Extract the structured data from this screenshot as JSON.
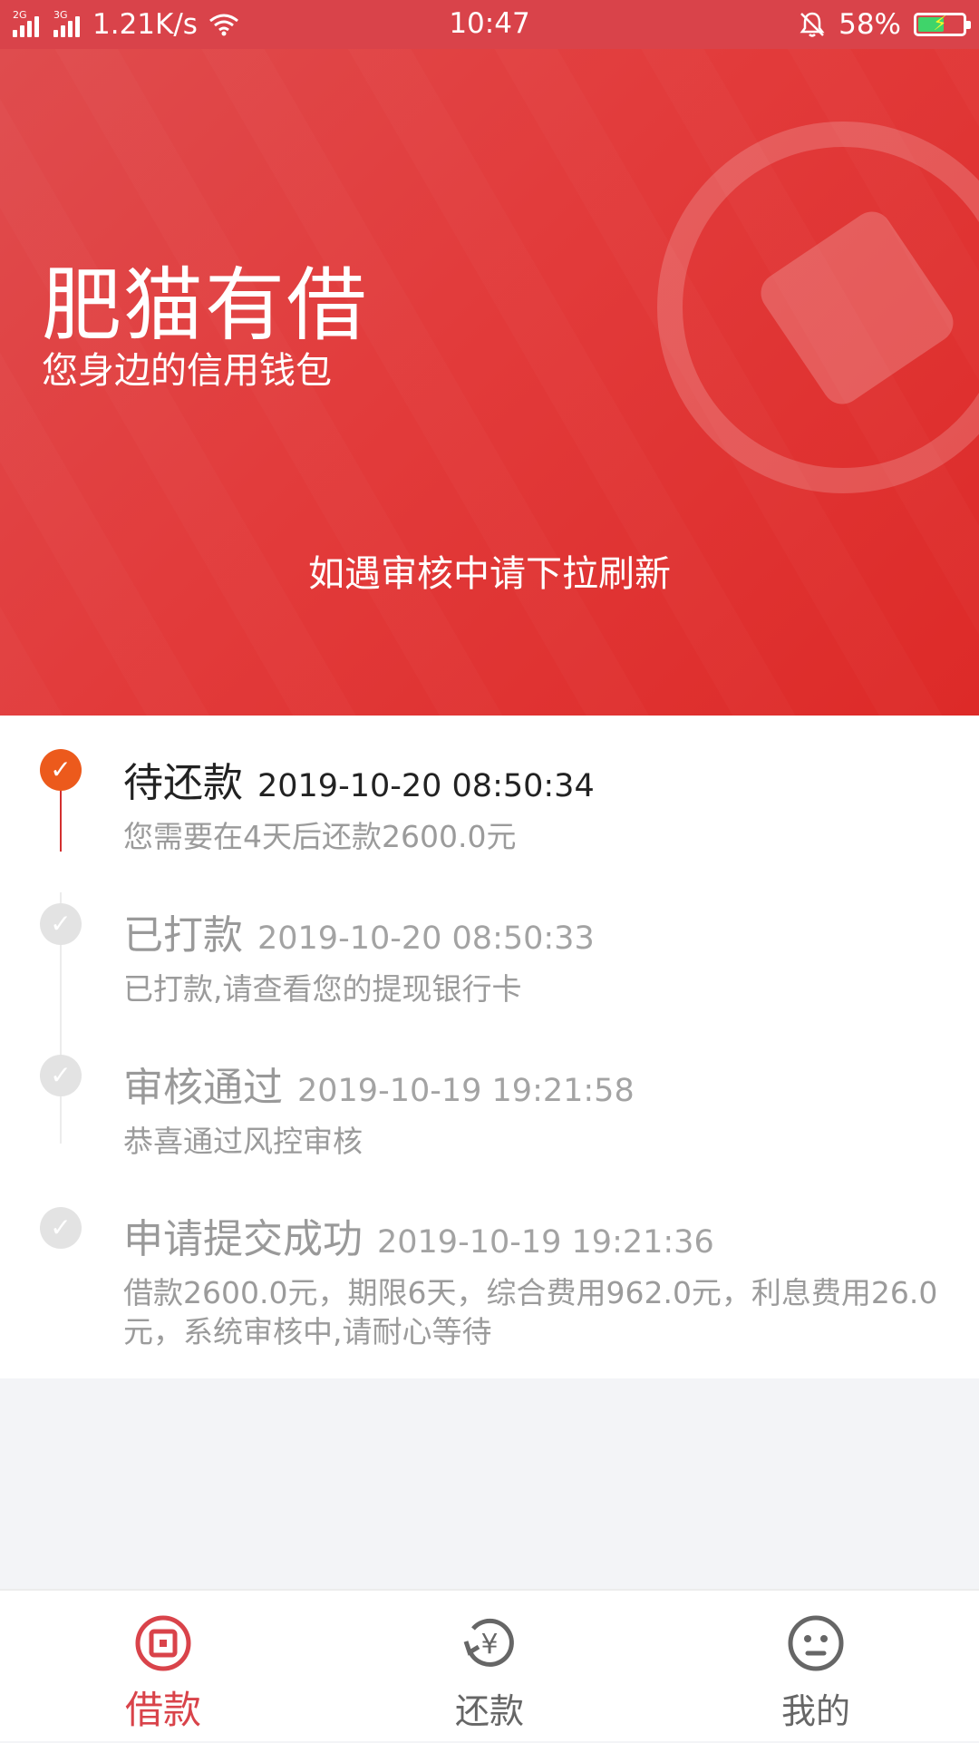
{
  "status_bar": {
    "net1": "2G",
    "net2": "3G",
    "speed": "1.21K/s",
    "time": "10:47",
    "battery": "58%"
  },
  "hero": {
    "title": "肥猫有借",
    "subtitle": "您身边的信用钱包",
    "hint": "如遇审核中请下拉刷新"
  },
  "timeline": {
    "items": [
      {
        "title": "待还款",
        "timestamp": "2019-10-20 08:50:34",
        "desc": "您需要在4天后还款2600.0元",
        "active": true
      },
      {
        "title": "已打款",
        "timestamp": "2019-10-20 08:50:33",
        "desc": "已打款,请查看您的提现银行卡",
        "active": false
      },
      {
        "title": "审核通过",
        "timestamp": "2019-10-19 19:21:58",
        "desc": "恭喜通过风控审核",
        "active": false
      },
      {
        "title": "申请提交成功",
        "timestamp": "2019-10-19 19:21:36",
        "desc": "借款2600.0元，期限6天，综合费用962.0元，利息费用26.0元，系统审核中,请耐心等待",
        "active": false
      }
    ]
  },
  "bottom_nav": {
    "items": [
      {
        "label": "借款",
        "icon": "loan-icon",
        "active": true
      },
      {
        "label": "还款",
        "icon": "repay-icon",
        "active": false
      },
      {
        "label": "我的",
        "icon": "profile-face-icon",
        "active": false
      }
    ]
  },
  "colors": {
    "brand_red": "#d9434a",
    "active_orange": "#ec5a1c"
  }
}
